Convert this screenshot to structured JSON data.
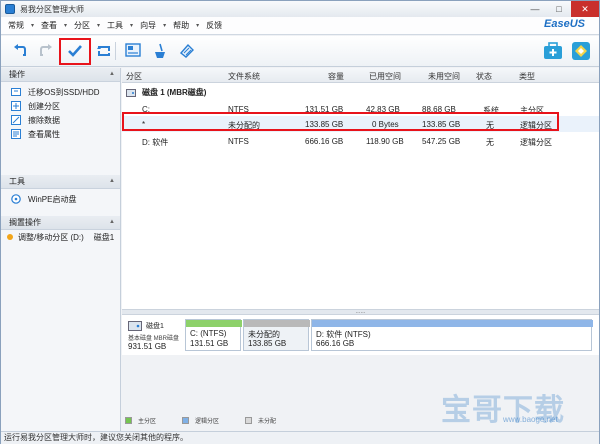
{
  "window": {
    "title": "易我分区管理大师",
    "minimize": "—",
    "maximize": "□",
    "close": "✕"
  },
  "menu": [
    "常规",
    "查看",
    "分区",
    "工具",
    "向导",
    "帮助",
    "反馈"
  ],
  "brand": {
    "logo": "EaseUS"
  },
  "toolbar": {
    "undo_icon": "undo-icon",
    "redo_icon": "redo-icon",
    "apply_icon": "check-icon",
    "refresh_icon": "refresh-icon",
    "partition_icon": "partition-icon",
    "wipe_icon": "wipe-icon",
    "tag_icon": "tag-icon",
    "highlight_color": "#e8131b"
  },
  "left_panel": {
    "operations_title": "操作",
    "operations": [
      "迁移OS到SSD/HDD",
      "创建分区",
      "擦除数据",
      "查看属性"
    ],
    "tools_title": "工具",
    "tools": [
      "WinPE启动盘"
    ],
    "pending_title": "搁置操作",
    "pending": [
      {
        "label": "调整/移动分区 (D:)",
        "disk": "磁盘1"
      }
    ]
  },
  "table": {
    "headers": [
      "分区",
      "文件系统",
      "容量",
      "已用空间",
      "未用空间",
      "状态",
      "类型"
    ],
    "disk_label": "磁盘 1 (MBR磁盘)",
    "rows": [
      {
        "partition": "C:",
        "fs": "NTFS",
        "capacity": "131.51 GB",
        "used": "42.83 GB",
        "free": "88.68 GB",
        "status": "系统",
        "type": "主分区"
      },
      {
        "partition": "*",
        "fs": "未分配的",
        "capacity": "133.85 GB",
        "used": "0 Bytes",
        "free": "133.85 GB",
        "status": "无",
        "type": "逻辑分区"
      },
      {
        "partition": "D: 软件",
        "fs": "NTFS",
        "capacity": "666.16 GB",
        "used": "118.90 GB",
        "free": "547.25 GB",
        "status": "无",
        "type": "逻辑分区"
      }
    ]
  },
  "disk_map": {
    "disk_name": "磁盘1",
    "disk_type": "基本磁盘 MBR磁盘",
    "disk_size": "931.51 GB",
    "parts": [
      {
        "name": "C: (NTFS)",
        "size": "131.51 GB",
        "color": "#8dd16a"
      },
      {
        "name": "未分配的",
        "size": "133.85 GB",
        "color": "#b9b9b9"
      },
      {
        "name": "D: 软件 (NTFS)",
        "size": "666.16 GB",
        "color": "#8fb6e8"
      }
    ]
  },
  "legend": [
    {
      "label": "主分区",
      "color": "#74c450"
    },
    {
      "label": "逻辑分区",
      "color": "#7fb0e6"
    },
    {
      "label": "未分配",
      "color": "#d9d9d9"
    }
  ],
  "status_text": "运行易我分区管理大师时，建议您关闭其他的程序。",
  "watermark": {
    "big": "宝哥下载",
    "url": "www.baoge.net"
  }
}
